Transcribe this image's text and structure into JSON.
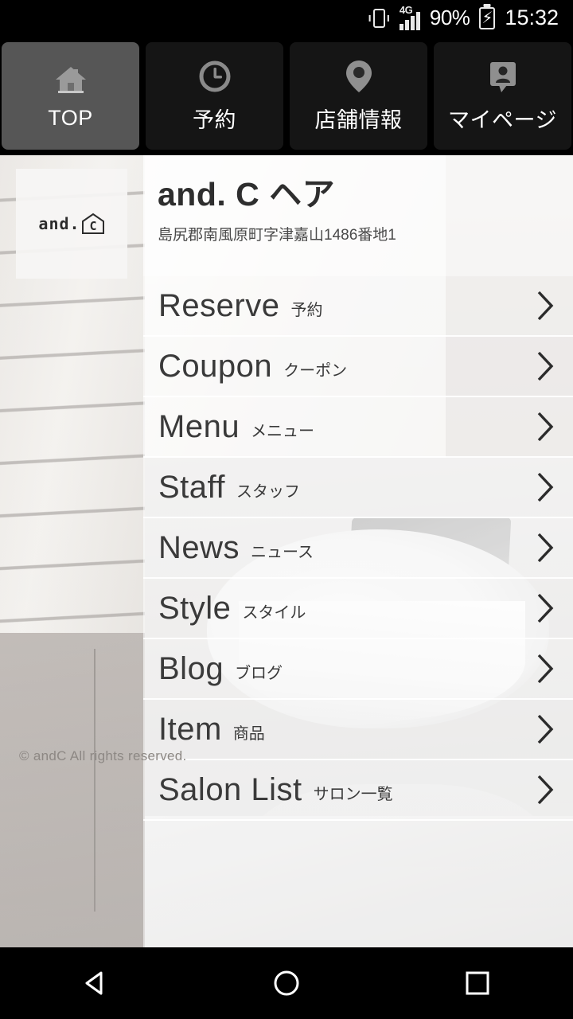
{
  "status_bar": {
    "vibrate_icon": "vibrate-icon",
    "network_type": "4G",
    "signal_icon": "signal-bars-icon",
    "battery_percent": "90%",
    "battery_icon": "battery-charging-icon",
    "time": "15:32"
  },
  "tabs": [
    {
      "label": "TOP",
      "icon": "home-icon",
      "active": true
    },
    {
      "label": "予約",
      "icon": "clock-icon",
      "active": false
    },
    {
      "label": "店舗情報",
      "icon": "map-pin-icon",
      "active": false
    },
    {
      "label": "マイページ",
      "icon": "person-badge-icon",
      "active": false
    }
  ],
  "logo": {
    "name": "and-c-logo",
    "text": "and.",
    "mark_letter": "C"
  },
  "header": {
    "shop_name": "and. C ヘア",
    "address": "島尻郡南風原町字津嘉山1486番地1"
  },
  "menu": {
    "items": [
      {
        "en": "Reserve",
        "ja": "予約"
      },
      {
        "en": "Coupon",
        "ja": "クーポン"
      },
      {
        "en": "Menu",
        "ja": "メニュー"
      },
      {
        "en": "Staff",
        "ja": "スタッフ"
      },
      {
        "en": "News",
        "ja": "ニュース"
      },
      {
        "en": "Style",
        "ja": "スタイル"
      },
      {
        "en": "Blog",
        "ja": "ブログ"
      },
      {
        "en": "Item",
        "ja": "商品"
      },
      {
        "en": "Salon List",
        "ja": "サロン一覧"
      }
    ],
    "chevron_icon": "chevron-right-icon"
  },
  "footer": {
    "copyright": "© andC All rights reserved."
  },
  "nav_bar": {
    "back_icon": "back-triangle-icon",
    "home_icon": "home-circle-icon",
    "recents_icon": "recents-square-icon"
  },
  "colors": {
    "status_bar_bg": "#000000",
    "tab_active_bg": "#565656",
    "tab_inactive_bg": "#151515",
    "tab_label": "#ffffff",
    "menu_text": "#3a3a3a",
    "title_text": "#2e2e2e",
    "copyright_text": "#8d8884"
  }
}
